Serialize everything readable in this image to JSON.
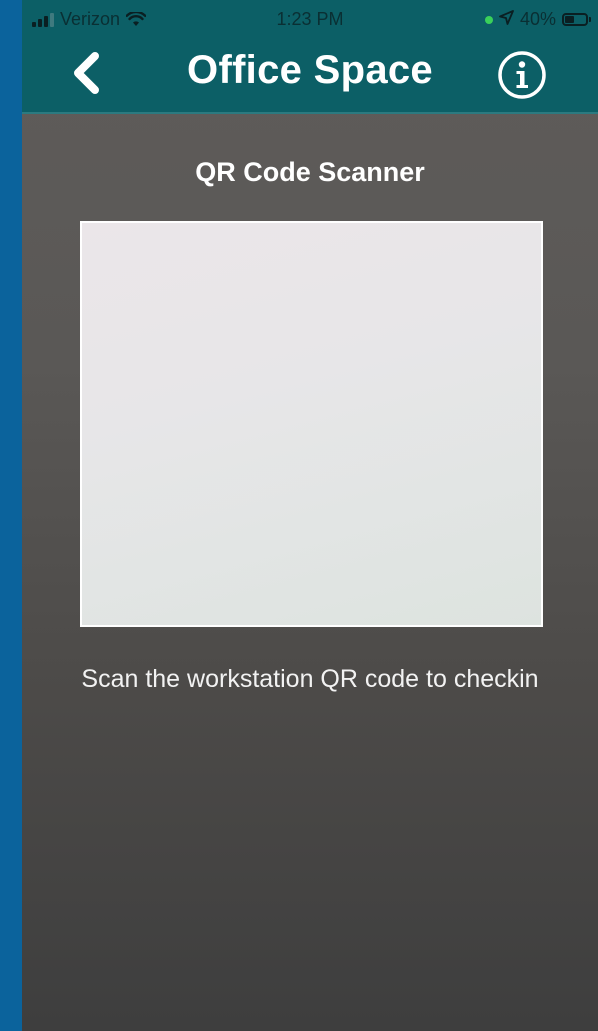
{
  "status_bar": {
    "carrier": "Verizon",
    "time": "1:23 PM",
    "battery_percent": "40%",
    "battery_level": 0.4,
    "icons": [
      "signal-icon",
      "wifi-icon",
      "location-arrow-icon",
      "battery-icon"
    ]
  },
  "header": {
    "title": "Office Space",
    "back_icon": "chevron-left-icon",
    "info_icon": "info-icon"
  },
  "scanner": {
    "title": "QR Code Scanner",
    "instruction": "Scan the workstation QR code to checkin"
  },
  "colors": {
    "header_bg": "#0c5f66",
    "outer_bg": "#0a6099",
    "screen_bg": "#5a5856",
    "text": "#ffffff",
    "active_dot": "#3ad05a"
  }
}
